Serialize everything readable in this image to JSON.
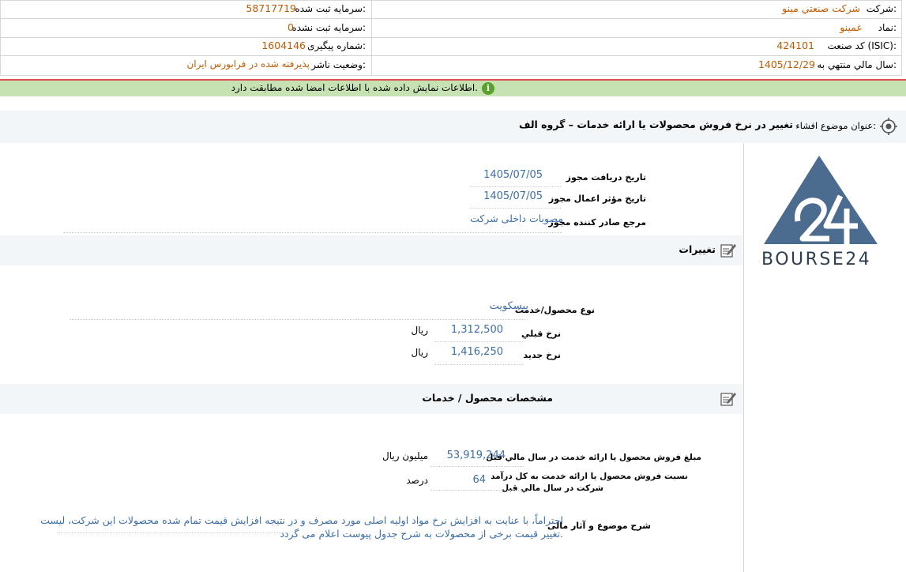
{
  "header": {
    "company_label": "شرکت:",
    "company_value": "شرکت صنعتي مينو",
    "capital_reg_label": "سرمايه ثبت شده:",
    "capital_reg_value": "58717719",
    "symbol_label": "نماد:",
    "symbol_value": "غمينو",
    "capital_unreg_label": "سرمايه ثبت نشده:",
    "capital_unreg_value": "0",
    "isic_label": "کد صنعت (ISIC):",
    "isic_value": "424101",
    "tracking_label": "شماره پيگيری:",
    "tracking_value": "1604146",
    "fiscal_label": "سال مالي منتهي به:",
    "fiscal_value": "1405/12/29",
    "status_label": "وضعيت ناشر:",
    "status_value": "پذيرفته شده در فرابورس ايران"
  },
  "notice": {
    "text": "اطلاعات نمايش داده شده با اطلاعات امضا شده مطابقت دارد."
  },
  "subject": {
    "label": "عنوان موضوع افشاء:",
    "value": "تغيير در نرخ فروش محصولات يا ارائه خدمات – گروه الف"
  },
  "permit": {
    "receive_label": "تاريخ دريافت مجوز",
    "receive_value": "1405/07/05",
    "effective_label": "تاريخ مؤثر اعمال مجوز",
    "effective_value": "1405/07/05",
    "issuer_label": "مرجع صادر کننده مجوز",
    "issuer_value": "مصوبات داخلی شرکت"
  },
  "changes": {
    "title": "تغييرات",
    "product_type_label": "نوع محصول/خدمت",
    "product_type_value": "بيسکويت",
    "old_price_label": "نرخ قبلي",
    "old_price_value": "1,312,500",
    "old_price_unit": "ريال",
    "new_price_label": "نرخ جديد",
    "new_price_value": "1,416,250",
    "new_price_unit": "ريال"
  },
  "specs": {
    "title": "مشخصات محصول / خدمات",
    "sales_label": "مبلغ فروش محصول يا ارائه خدمت در سال مالي قبل",
    "sales_value": "53,919,244",
    "sales_unit": "ميليون ريال",
    "ratio_label_1": "نسبت فروش محصول يا ارائه خدمت به کل درآمد",
    "ratio_label_2": "شرکت در سال مالي قبل",
    "ratio_value": "64",
    "ratio_unit": "درصد",
    "desc_label": "شرح موضوع و آثار مالی",
    "desc_line_1": "احتراماً، با عنايت به افزايش نرخ مواد اوليه اصلی مورد مصرف و در نتيجه افزايش قيمت تمام شده محصولات اين شرکت، ليست",
    "desc_line_2": "تغيير قيمت برخی از محصولات به شرح جدول پيوست اعلام می گردد."
  },
  "logo": {
    "text": "BOURSE24",
    "color": "#4b6b8f"
  },
  "colors": {
    "value_orange": "#c45a00",
    "value_blue": "#3c6ea8",
    "notice_bg": "#c6e2b3",
    "notice_border": "#e05050",
    "band_bg": "#f3f6f9"
  }
}
